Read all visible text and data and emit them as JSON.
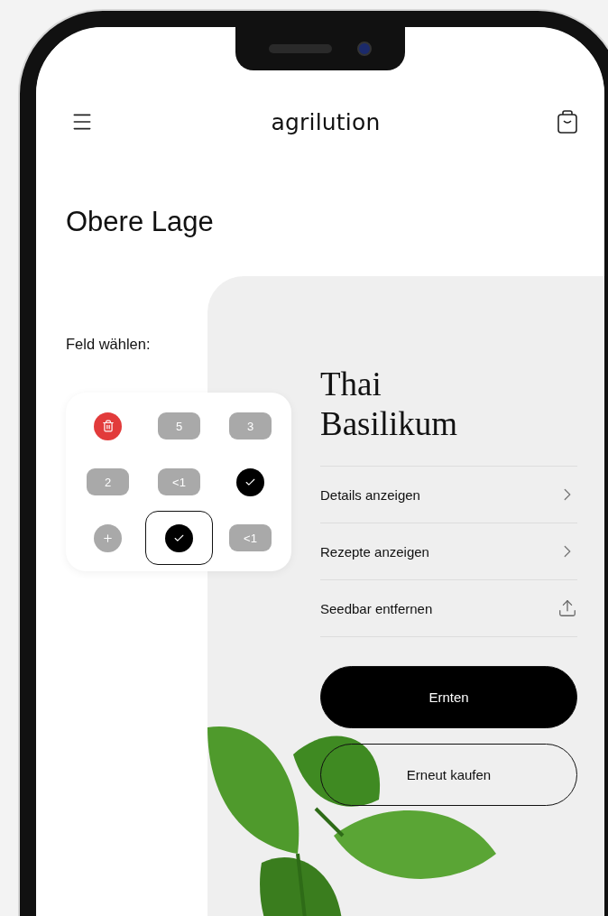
{
  "header": {
    "logo": "agrilution"
  },
  "title": "Obere Lage",
  "field_picker": {
    "label": "Feld wählen:",
    "fields": [
      {
        "kind": "delete",
        "selected": false
      },
      {
        "kind": "count",
        "label": "5",
        "selected": false
      },
      {
        "kind": "count",
        "label": "3",
        "selected": false
      },
      {
        "kind": "count",
        "label": "2",
        "selected": false
      },
      {
        "kind": "count",
        "label": "<1",
        "selected": false
      },
      {
        "kind": "done",
        "selected": false
      },
      {
        "kind": "add",
        "selected": false
      },
      {
        "kind": "done",
        "selected": true
      },
      {
        "kind": "count",
        "label": "<1",
        "selected": false
      }
    ]
  },
  "plant": {
    "name": "Thai Basilikum",
    "actions": [
      {
        "label": "Details anzeigen",
        "kind": "link"
      },
      {
        "label": "Rezepte anzeigen",
        "kind": "link"
      },
      {
        "label": "Seedbar entfernen",
        "kind": "share"
      }
    ],
    "buttons": [
      {
        "label": "Ernten",
        "kind": "primary"
      },
      {
        "label": "Erneut kaufen",
        "kind": "outline"
      }
    ]
  }
}
